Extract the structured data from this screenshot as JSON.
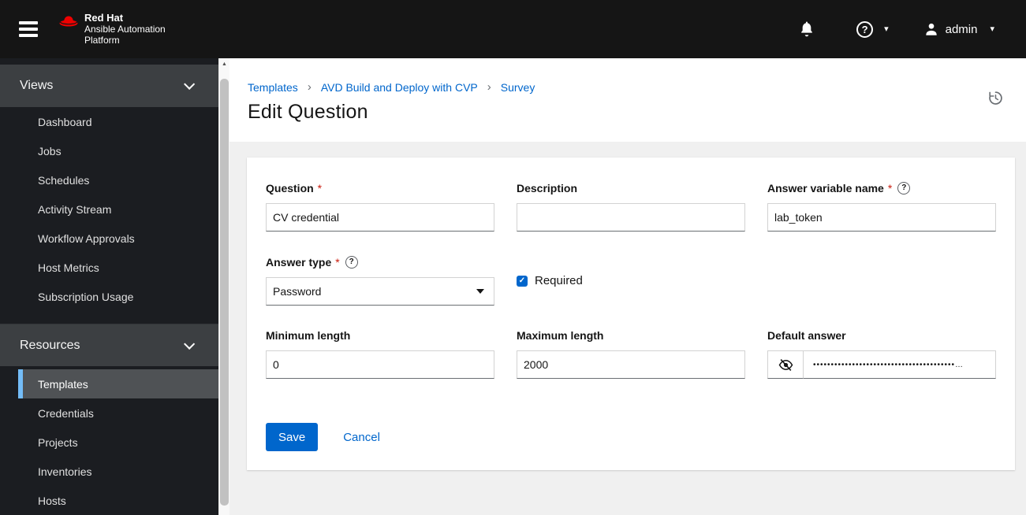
{
  "app": {
    "brand_line1": "Red Hat",
    "brand_line2": "Ansible Automation",
    "brand_line3": "Platform"
  },
  "header": {
    "username": "admin"
  },
  "icons": {
    "help_glyph": "?",
    "caret": "▾",
    "check": "✓",
    "scroll_up": "▲"
  },
  "sidebar": {
    "sections": [
      {
        "label": "Views",
        "items": [
          {
            "label": "Dashboard"
          },
          {
            "label": "Jobs"
          },
          {
            "label": "Schedules"
          },
          {
            "label": "Activity Stream"
          },
          {
            "label": "Workflow Approvals"
          },
          {
            "label": "Host Metrics"
          },
          {
            "label": "Subscription Usage"
          }
        ]
      },
      {
        "label": "Resources",
        "items": [
          {
            "label": "Templates",
            "selected": true
          },
          {
            "label": "Credentials"
          },
          {
            "label": "Projects"
          },
          {
            "label": "Inventories"
          },
          {
            "label": "Hosts"
          }
        ]
      }
    ]
  },
  "breadcrumb": {
    "separator": "›",
    "items": [
      "Templates",
      "AVD Build and Deploy with CVP",
      "Survey"
    ]
  },
  "page": {
    "title": "Edit Question"
  },
  "form": {
    "required_marker": "*",
    "question": {
      "label": "Question",
      "value": "CV credential"
    },
    "description": {
      "label": "Description",
      "value": ""
    },
    "answer_variable_name": {
      "label": "Answer variable name",
      "value": "lab_token"
    },
    "answer_type": {
      "label": "Answer type",
      "value": "Password"
    },
    "required_checkbox": {
      "label": "Required",
      "checked": true
    },
    "minimum_length": {
      "label": "Minimum length",
      "value": "0"
    },
    "maximum_length": {
      "label": "Maximum length",
      "value": "2000"
    },
    "default_answer": {
      "label": "Default answer",
      "masked_value": "••••••••••••••••••••••••••••••••••••••••…"
    },
    "buttons": {
      "save": "Save",
      "cancel": "Cancel"
    }
  },
  "colors": {
    "accent": "#0066cc",
    "nav_selected_indicator": "#73bcf7",
    "required_red": "#c9190b",
    "header_bg": "#151515",
    "sidebar_bg": "#1b1d21",
    "section_band_bg": "#3c3f42",
    "selected_item_bg": "#4f5255",
    "body_bg": "#f0f0f0"
  }
}
